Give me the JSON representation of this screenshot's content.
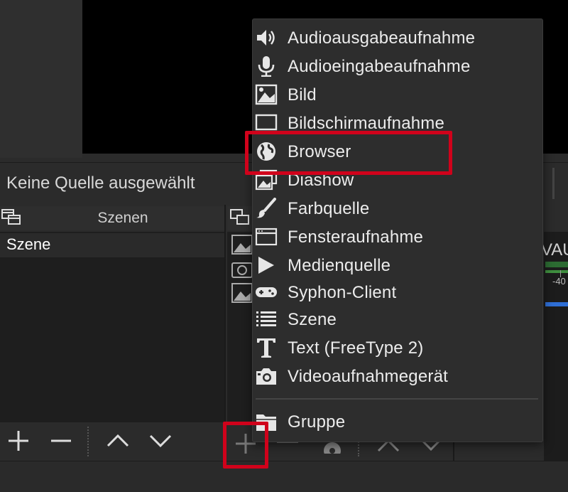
{
  "context_bar": {
    "no_source": "Keine Quelle ausgewählt"
  },
  "scenes": {
    "title": "Szenen",
    "items": [
      {
        "label": "Szene"
      }
    ]
  },
  "mixer": {
    "label": "VAU",
    "db_label": "-40"
  },
  "menu": {
    "items": [
      {
        "label": "Audioausgabeaufnahme",
        "icon": "speaker-icon"
      },
      {
        "label": "Audioeingabeaufnahme",
        "icon": "microphone-icon"
      },
      {
        "label": "Bild",
        "icon": "image-icon"
      },
      {
        "label": "Bildschirmaufnahme",
        "icon": "monitor-icon"
      },
      {
        "label": "Browser",
        "icon": "globe-icon"
      },
      {
        "label": "Diashow",
        "icon": "slideshow-icon"
      },
      {
        "label": "Farbquelle",
        "icon": "paintbrush-icon"
      },
      {
        "label": "Fensteraufnahme",
        "icon": "window-icon"
      },
      {
        "label": "Medienquelle",
        "icon": "play-icon"
      },
      {
        "label": "Syphon-Client",
        "icon": "gamepad-icon"
      },
      {
        "label": "Szene",
        "icon": "list-icon"
      },
      {
        "label": "Text (FreeType 2)",
        "icon": "text-icon"
      },
      {
        "label": "Videoaufnahmegerät",
        "icon": "camera-icon"
      }
    ],
    "group": {
      "label": "Gruppe",
      "icon": "folder-icon"
    }
  },
  "colors": {
    "highlight": "#d0021b",
    "menu_bg": "#2d2d2d",
    "panel_bg": "#2b2b2b"
  }
}
